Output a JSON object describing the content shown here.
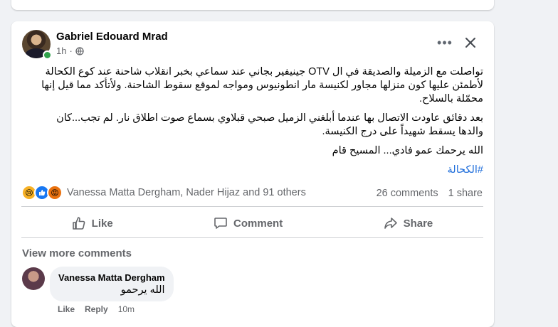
{
  "post": {
    "author": "Gabriel Edouard Mrad",
    "time": "1h",
    "more_icon": "more-horizontal-icon",
    "close_icon": "close-icon",
    "paragraphs": [
      "تواصلت مع الزميلة والصديقة في ال OTV جينيفير بجاني عند سماعي بخبر انقلاب شاحنة عند كوع الكحالة لأطمئن عليها كون منزلها مجاور لكنيسة مار انطونيوس ومواجه لموقع سقوط الشاحنة. ولأتأكد مما قيل إنها محمّلة بالسلاح.",
      "بعد دقائق عاودت الاتصال بها عندما أبلغني الزميل صبحي قبلاوي بسماع صوت اطلاق نار. لم تجب...كان والدها يسقط شهيداً على درج الكنيسة.",
      "الله يرحمك عمو فادي... المسيح قام"
    ],
    "hashtag": "#الكحالة",
    "reactions_text": "Vanessa Matta Dergham, Nader Hijaz and 91 others",
    "comments_count": "26 comments",
    "shares_count": "1 share"
  },
  "actions": {
    "like": "Like",
    "comment": "Comment",
    "share": "Share"
  },
  "comments": {
    "view_more": "View more comments",
    "items": [
      {
        "author": "Vanessa Matta Dergham",
        "text": "الله يرحمو",
        "like": "Like",
        "reply": "Reply",
        "time": "10m"
      }
    ]
  },
  "colors": {
    "accent": "#1877f2",
    "hashtag": "#216fdb",
    "muted": "#65676b",
    "online": "#31a24c"
  }
}
